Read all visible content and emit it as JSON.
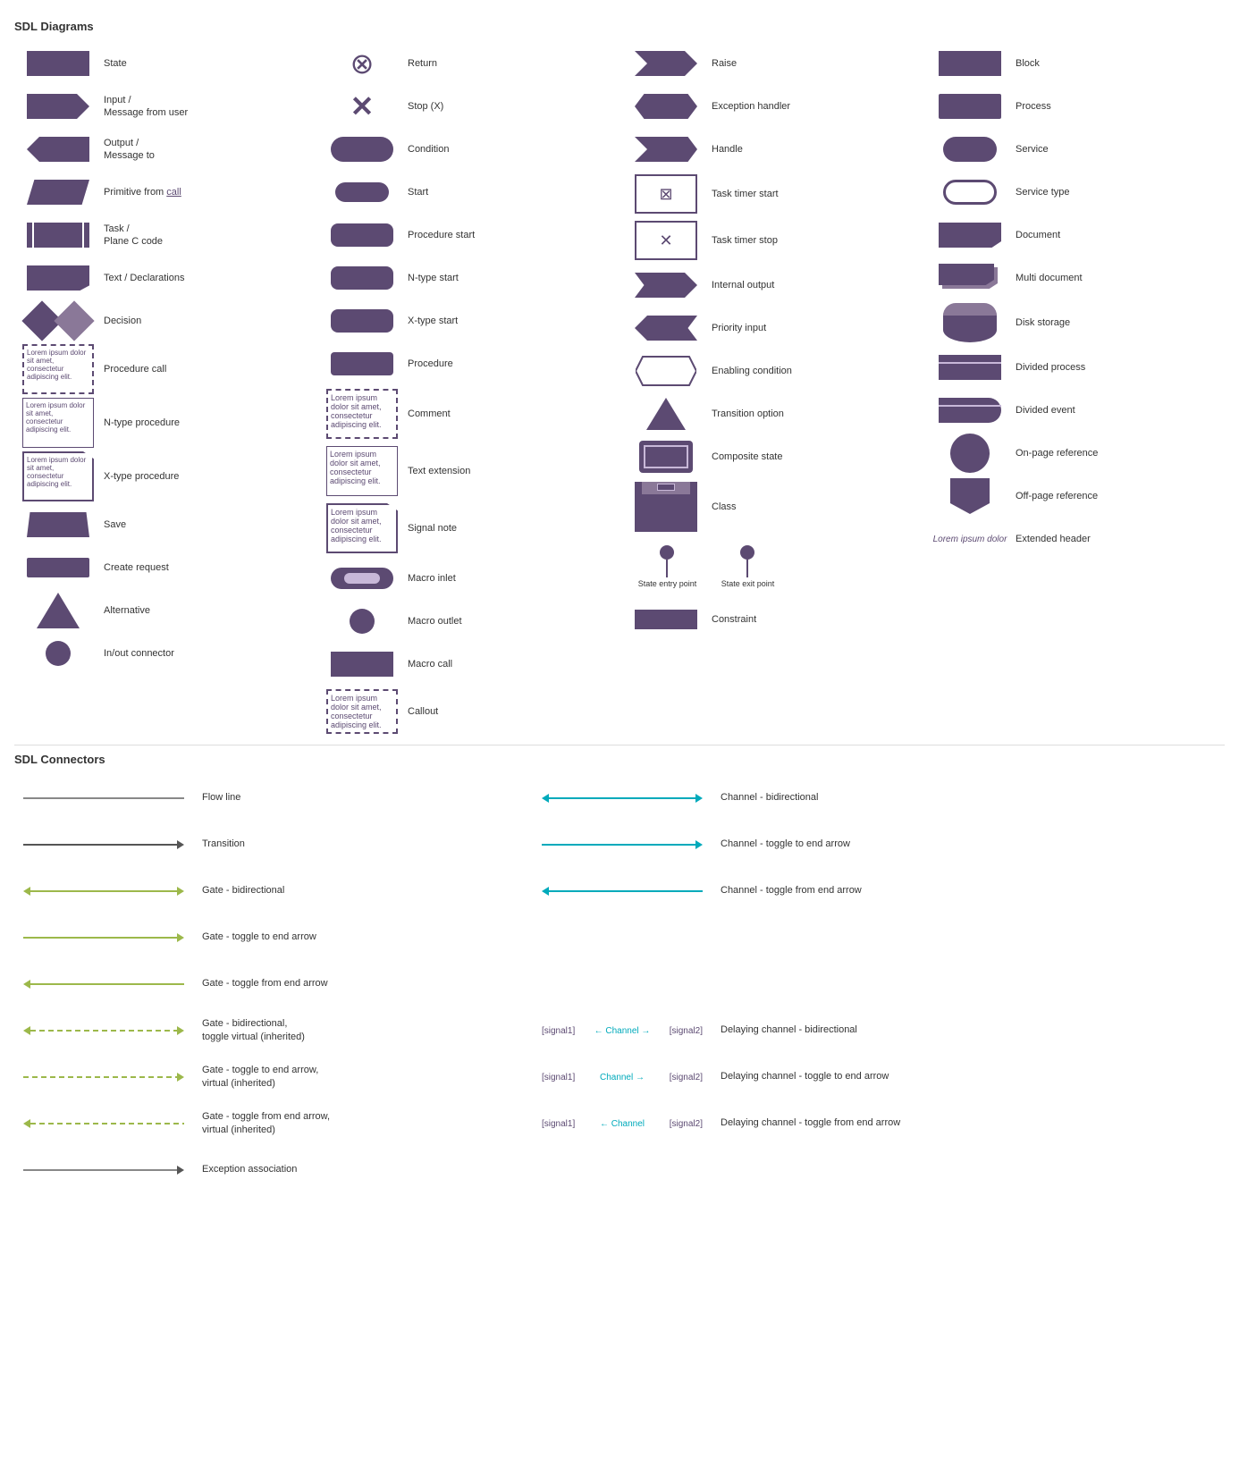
{
  "page": {
    "title": "SDL Diagrams",
    "connectors_title": "SDL Connectors"
  },
  "shapes": {
    "col1": [
      {
        "id": "state",
        "label": "State"
      },
      {
        "id": "input",
        "label": "Input /\nMessage from user"
      },
      {
        "id": "output",
        "label": "Output /\nMessage to"
      },
      {
        "id": "primitive",
        "label": "Primitive from call"
      },
      {
        "id": "task",
        "label": "Task /\nPlane C code"
      },
      {
        "id": "text-decl",
        "label": "Text / Declarations"
      },
      {
        "id": "decision",
        "label": "Decision"
      },
      {
        "id": "proc-call",
        "label": "Procedure call"
      },
      {
        "id": "ntype-proc",
        "label": "N-type procedure"
      },
      {
        "id": "xtype-proc",
        "label": "X-type procedure"
      },
      {
        "id": "save",
        "label": "Save"
      },
      {
        "id": "create",
        "label": "Create request"
      },
      {
        "id": "alternative",
        "label": "Alternative"
      },
      {
        "id": "inout-conn",
        "label": "In/out connector"
      }
    ],
    "col2": [
      {
        "id": "return",
        "label": "Return"
      },
      {
        "id": "stop",
        "label": "Stop (X)"
      },
      {
        "id": "condition",
        "label": "Condition"
      },
      {
        "id": "start",
        "label": "Start"
      },
      {
        "id": "proc-start",
        "label": "Procedure start"
      },
      {
        "id": "ntype-start",
        "label": "N-type start"
      },
      {
        "id": "xtype-start",
        "label": "X-type start"
      },
      {
        "id": "procedure",
        "label": "Procedure"
      },
      {
        "id": "comment",
        "label": "Comment"
      },
      {
        "id": "text-ext",
        "label": "Text extension"
      },
      {
        "id": "signal-note",
        "label": "Signal note"
      },
      {
        "id": "macro-inlet",
        "label": "Macro inlet"
      },
      {
        "id": "macro-outlet",
        "label": "Macro outlet"
      },
      {
        "id": "macro-call",
        "label": "Macro call"
      },
      {
        "id": "callout",
        "label": "Callout"
      }
    ],
    "col3": [
      {
        "id": "raise",
        "label": "Raise"
      },
      {
        "id": "exc-handler",
        "label": "Exception handler"
      },
      {
        "id": "handle",
        "label": "Handle"
      },
      {
        "id": "task-timer-start",
        "label": "Task timer start"
      },
      {
        "id": "task-timer-stop",
        "label": "Task timer stop"
      },
      {
        "id": "internal-output",
        "label": "Internal output"
      },
      {
        "id": "priority-input",
        "label": "Priority input"
      },
      {
        "id": "enabling-cond",
        "label": "Enabling condition"
      },
      {
        "id": "transition-opt",
        "label": "Transition option"
      },
      {
        "id": "composite-state",
        "label": "Composite state"
      },
      {
        "id": "class",
        "label": "Class"
      },
      {
        "id": "state-entry",
        "label": "State entry point"
      },
      {
        "id": "state-exit",
        "label": "State exit point"
      },
      {
        "id": "constraint",
        "label": "Constraint"
      }
    ],
    "col4": [
      {
        "id": "block",
        "label": "Block"
      },
      {
        "id": "process",
        "label": "Process"
      },
      {
        "id": "service",
        "label": "Service"
      },
      {
        "id": "service-type",
        "label": "Service type"
      },
      {
        "id": "document",
        "label": "Document"
      },
      {
        "id": "multi-doc",
        "label": "Multi document"
      },
      {
        "id": "disk",
        "label": "Disk storage"
      },
      {
        "id": "divided-process",
        "label": "Divided process"
      },
      {
        "id": "divided-event",
        "label": "Divided event"
      },
      {
        "id": "onpage-ref",
        "label": "On-page reference"
      },
      {
        "id": "offpage-ref",
        "label": "Off-page reference"
      },
      {
        "id": "ext-header",
        "label": "Extended header"
      }
    ]
  },
  "comment_text": "Lorem ipsum dolor sit amet, consectetur adipiscing elit.",
  "text_ext_text": "Lorem ipsum dolor sit amet, consectetur adipiscing elit.",
  "signal_note_text": "Lorem ipsum dolor sit amet, consectetur adipiscing elit.",
  "callout_text": "Lorem ipsum dolor sit amet, consectetur adipiscing elit.",
  "ext_header_text": "Lorem ipsum dolor",
  "connectors": [
    {
      "id": "flow-line",
      "label": "Flow line",
      "type": "flow"
    },
    {
      "id": "transition",
      "label": "Transition",
      "type": "transition"
    },
    {
      "id": "gate-bidir",
      "label": "Gate - bidirectional",
      "type": "gate-bidir"
    },
    {
      "id": "gate-toggle-end",
      "label": "Gate - toggle to end arrow",
      "type": "gate-toggle-end"
    },
    {
      "id": "gate-toggle-from",
      "label": "Gate - toggle from end arrow",
      "type": "gate-toggle-from"
    },
    {
      "id": "gate-bidir-virtual",
      "label": "Gate - bidirectional, toggle virtual (inherited)",
      "type": "gate-dashed-bidir"
    },
    {
      "id": "gate-toggle-end-virtual",
      "label": "Gate - toggle to end arrow, virtual (inherited)",
      "type": "gate-dashed-toggle-end"
    },
    {
      "id": "gate-toggle-from-virtual",
      "label": "Gate - toggle from end arrow, virtual (inherited)",
      "type": "gate-dashed-toggle-from"
    },
    {
      "id": "exception-assoc",
      "label": "Exception association",
      "type": "exception"
    }
  ],
  "right_connectors": [
    {
      "id": "channel-bidir",
      "label": "Channel - bidirectional",
      "type": "channel-bidir"
    },
    {
      "id": "channel-toggle-end",
      "label": "Channel - toggle to end arrow",
      "type": "channel-toggle-end"
    },
    {
      "id": "channel-toggle-from",
      "label": "Channel - toggle from end arrow",
      "type": "channel-toggle-from"
    },
    {
      "id": "delaying-bidir",
      "label": "Delaying channel - bidirectional",
      "type": "delaying-bidir"
    },
    {
      "id": "delaying-toggle-end",
      "label": "Delaying channel - toggle to end arrow",
      "type": "delaying-toggle-end"
    },
    {
      "id": "delaying-toggle-from",
      "label": "Delaying channel - toggle from end arrow",
      "type": "delaying-toggle-from"
    }
  ],
  "delaying_channel_labels": {
    "signal1": "[signal1]",
    "signal2": "[signal2]",
    "channel": "Channel"
  }
}
